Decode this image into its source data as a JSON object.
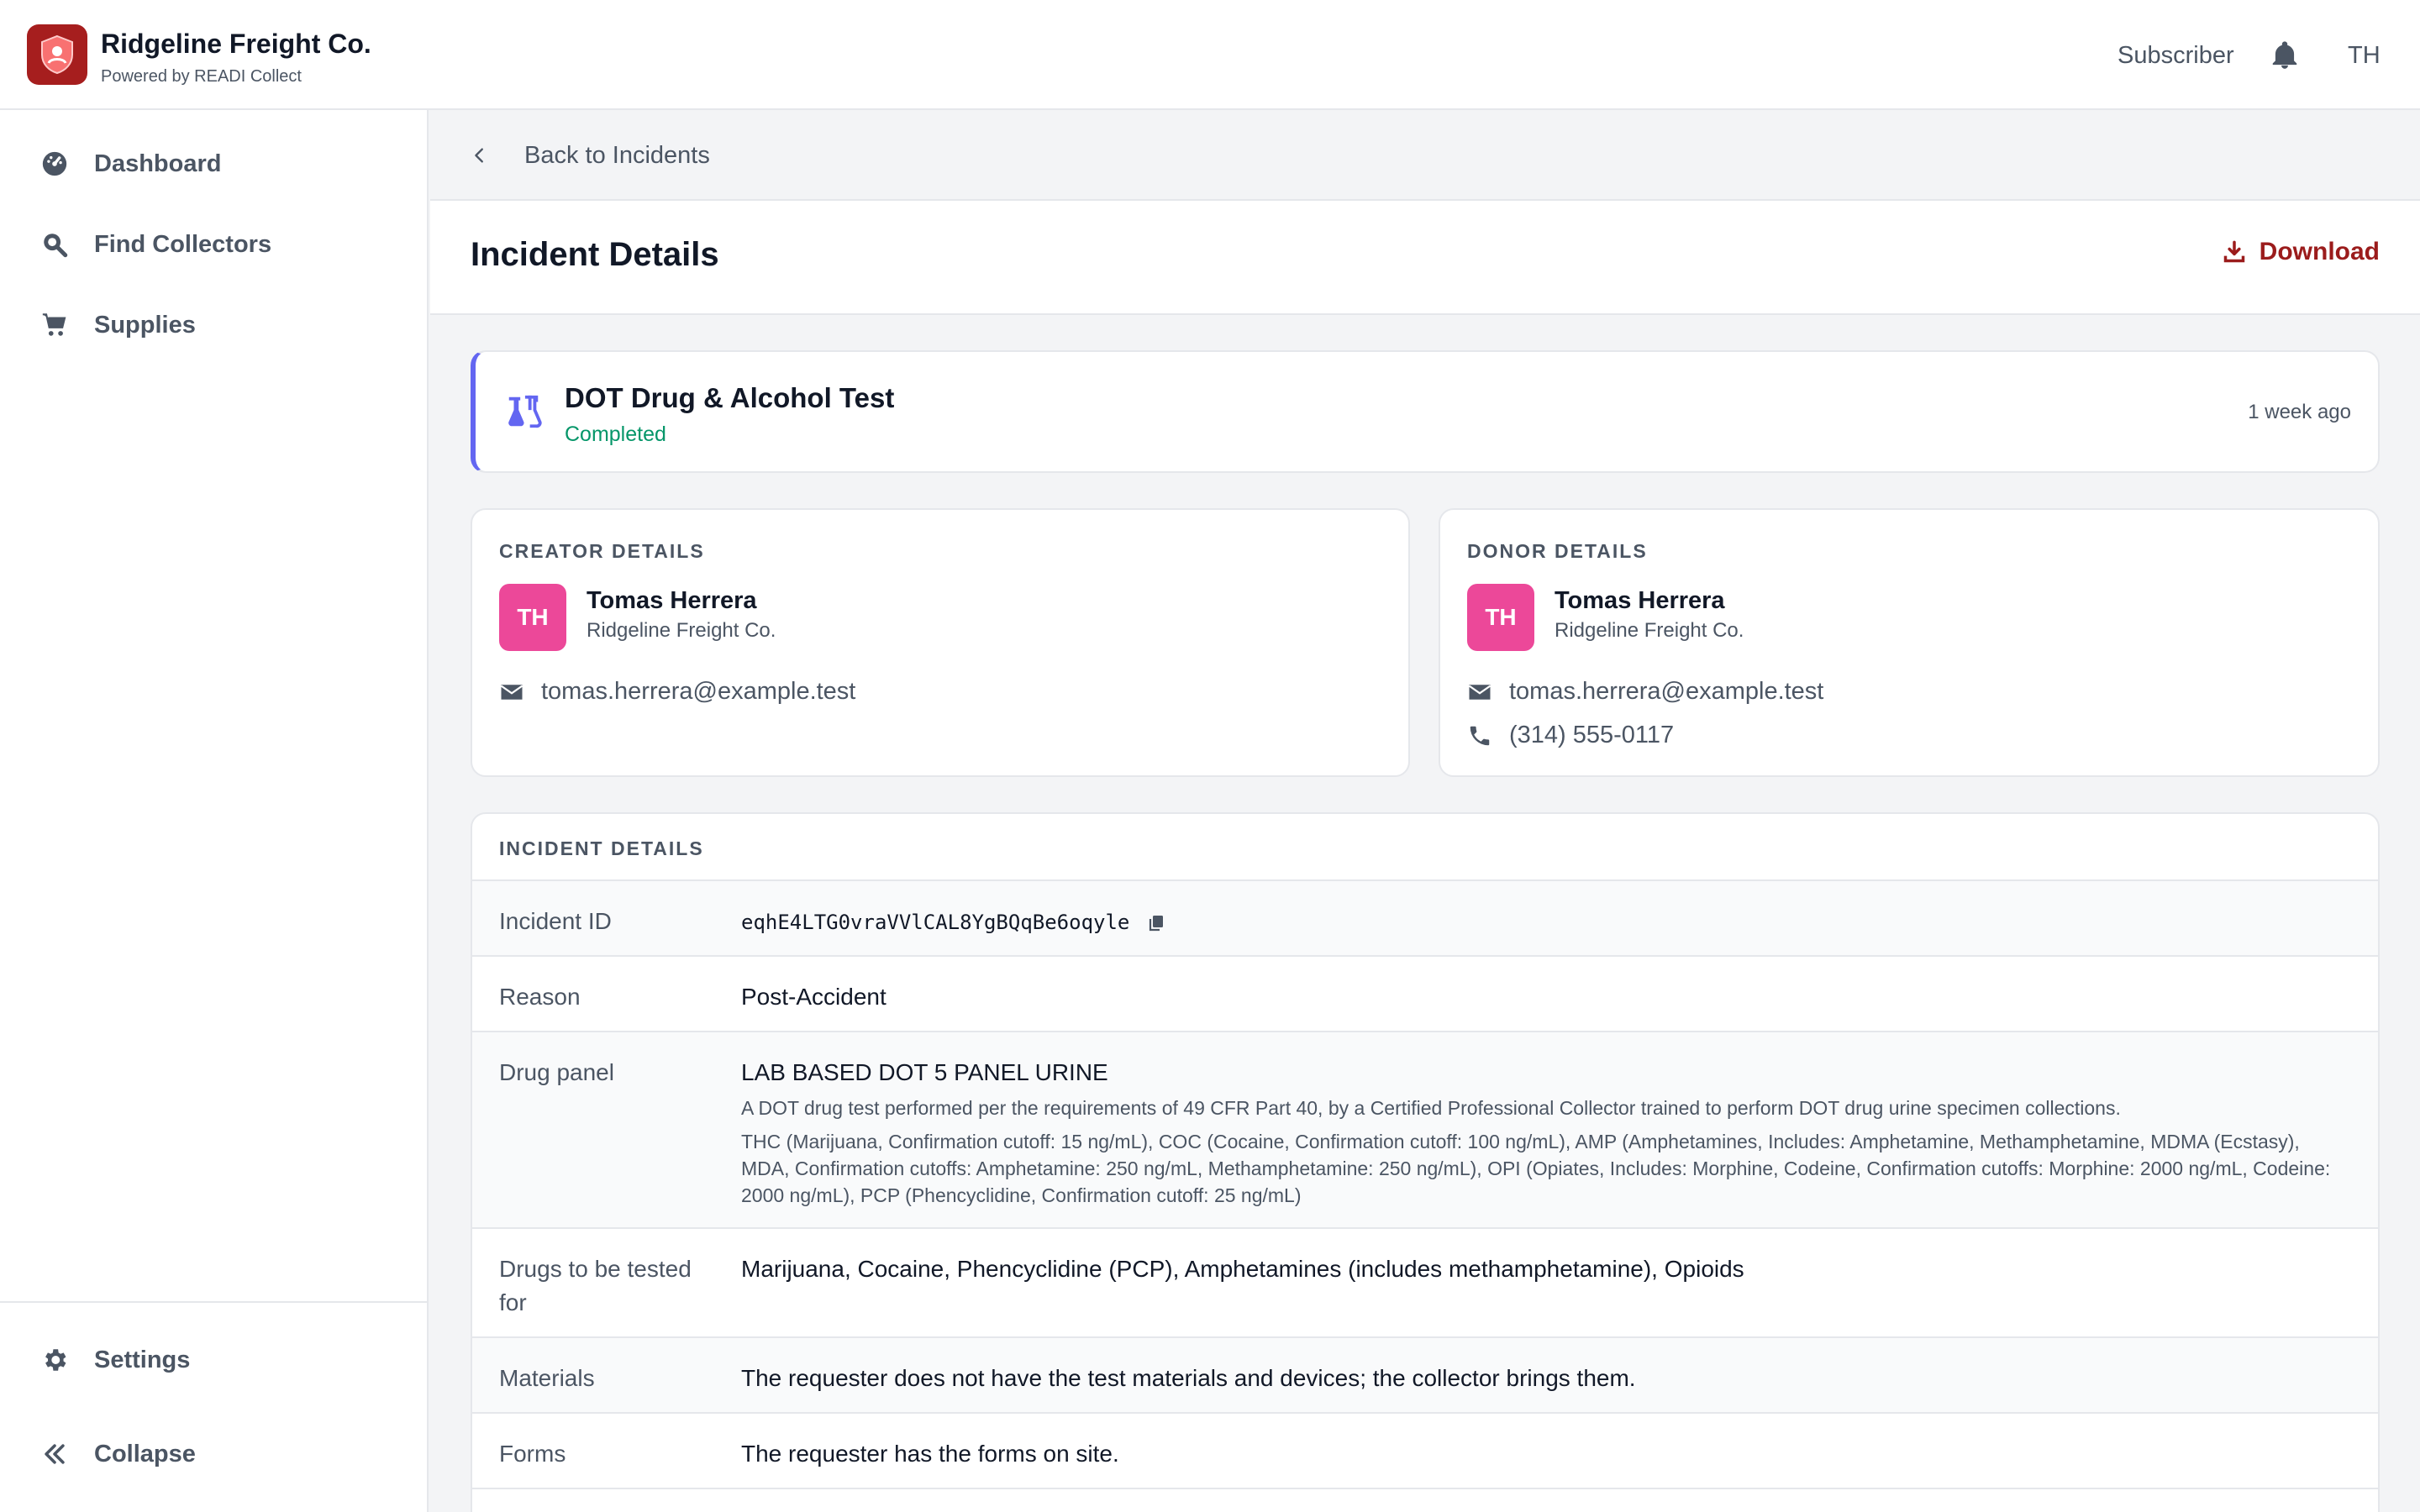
{
  "header": {
    "brand_title": "Ridgeline Freight Co.",
    "brand_subtitle": "Powered by READI Collect",
    "role": "Subscriber",
    "user_initials": "TH"
  },
  "sidebar": {
    "items": [
      {
        "label": "Dashboard",
        "icon": "gauge-icon"
      },
      {
        "label": "Find Collectors",
        "icon": "search-icon"
      },
      {
        "label": "Supplies",
        "icon": "cart-icon"
      }
    ],
    "bottom_items": [
      {
        "label": "Settings",
        "icon": "gear-icon"
      },
      {
        "label": "Collapse",
        "icon": "double-chevron-left-icon"
      }
    ]
  },
  "main": {
    "back_label": "Back to Incidents",
    "page_title": "Incident Details",
    "download_label": "Download",
    "test": {
      "name": "DOT Drug & Alcohol Test",
      "status": "Completed",
      "time": "1 week ago"
    },
    "creator": {
      "section": "CREATOR DETAILS",
      "initials": "TH",
      "name": "Tomas Herrera",
      "org": "Ridgeline Freight Co.",
      "email": "tomas.herrera@example.test"
    },
    "donor": {
      "section": "DONOR DETAILS",
      "initials": "TH",
      "name": "Tomas Herrera",
      "org": "Ridgeline Freight Co.",
      "email": "tomas.herrera@example.test",
      "phone": "(314) 555-0117"
    },
    "details": {
      "section": "INCIDENT DETAILS",
      "incident_id_label": "Incident ID",
      "incident_id": "eqhE4LTG0vraVVlCAL8YgBQqBe6oqyle",
      "reason_label": "Reason",
      "reason": "Post-Accident",
      "panel_label": "Drug panel",
      "panel_name": "LAB BASED DOT 5 PANEL URINE",
      "panel_desc": "A DOT drug test performed per the requirements of 49 CFR Part 40, by a Certified Professional Collector trained to perform DOT drug urine specimen collections.",
      "panel_drugs": "THC (Marijuana, Confirmation cutoff: 15 ng/mL), COC (Cocaine, Confirmation cutoff: 100 ng/mL), AMP (Amphetamines, Includes: Amphetamine, Methamphetamine, MDMA (Ecstasy), MDA, Confirmation cutoffs: Amphetamine: 250 ng/mL, Methamphetamine: 250 ng/mL), OPI (Opiates, Includes: Morphine, Codeine, Confirmation cutoffs: Morphine: 2000 ng/mL, Codeine: 2000 ng/mL), PCP (Phencyclidine, Confirmation cutoff: 25 ng/mL)",
      "drugs_label": "Drugs to be tested for",
      "drugs": "Marijuana, Cocaine, Phencyclidine (PCP), Amphetamines (includes methamphetamine), Opioids",
      "materials_label": "Materials",
      "materials": "The requester does not have the test materials and devices; the collector brings them.",
      "forms_label": "Forms",
      "forms": "The requester has the forms on site."
    }
  },
  "colors": {
    "brand": "#a61e1e",
    "accent": "#6366f1",
    "success": "#059669",
    "avatar": "#ec4899",
    "download": "#9b1c1c"
  }
}
